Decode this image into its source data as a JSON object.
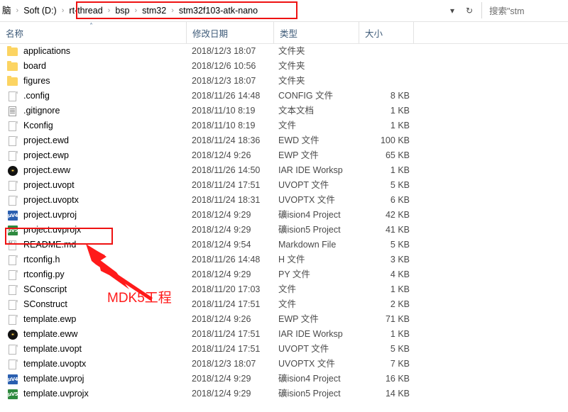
{
  "window": {
    "type": "file-explorer"
  },
  "address_bar": {
    "breadcrumbs": [
      {
        "label": "脑",
        "highlighted": false
      },
      {
        "label": "Soft (D:)",
        "highlighted": false
      },
      {
        "label": "rt-thread",
        "highlighted": true
      },
      {
        "label": "bsp",
        "highlighted": true
      },
      {
        "label": "stm32",
        "highlighted": true
      },
      {
        "label": "stm32f103-atk-nano",
        "highlighted": true
      }
    ],
    "separator": "›",
    "dropdown_icon": "chevron-down-icon",
    "refresh_icon": "refresh-icon",
    "refresh_glyph": "↻",
    "search_value": "搜索\"stm"
  },
  "columns": {
    "name": "名称",
    "date": "修改日期",
    "type": "类型",
    "size": "大小",
    "sort_caret": "˄"
  },
  "files": [
    {
      "name": "applications",
      "icon": "folder-icon",
      "date": "2018/12/3 18:07",
      "type": "文件夹",
      "size": ""
    },
    {
      "name": "board",
      "icon": "folder-icon",
      "date": "2018/12/6 10:56",
      "type": "文件夹",
      "size": ""
    },
    {
      "name": "figures",
      "icon": "folder-icon",
      "date": "2018/12/3 18:07",
      "type": "文件夹",
      "size": ""
    },
    {
      "name": ".config",
      "icon": "file-icon",
      "date": "2018/11/26 14:48",
      "type": "CONFIG 文件",
      "size": "8 KB"
    },
    {
      "name": ".gitignore",
      "icon": "text-document-icon",
      "date": "2018/11/10 8:19",
      "type": "文本文档",
      "size": "1 KB"
    },
    {
      "name": "Kconfig",
      "icon": "file-icon",
      "date": "2018/11/10 8:19",
      "type": "文件",
      "size": "1 KB"
    },
    {
      "name": "project.ewd",
      "icon": "file-icon",
      "date": "2018/11/24 18:36",
      "type": "EWD 文件",
      "size": "100 KB"
    },
    {
      "name": "project.ewp",
      "icon": "file-icon",
      "date": "2018/12/4 9:26",
      "type": "EWP 文件",
      "size": "65 KB"
    },
    {
      "name": "project.eww",
      "icon": "iar-workspace-icon",
      "date": "2018/11/26 14:50",
      "type": "IAR IDE Worksp",
      "size": "1 KB"
    },
    {
      "name": "project.uvopt",
      "icon": "file-icon",
      "date": "2018/11/24 17:51",
      "type": "UVOPT 文件",
      "size": "5 KB"
    },
    {
      "name": "project.uvoptx",
      "icon": "file-icon",
      "date": "2018/11/24 18:31",
      "type": "UVOPTX 文件",
      "size": "6 KB"
    },
    {
      "name": "project.uvproj",
      "icon": "uvision4-icon",
      "date": "2018/12/4 9:29",
      "type": "礦ision4 Project",
      "size": "42 KB"
    },
    {
      "name": "project.uvprojx",
      "icon": "uvision5-icon",
      "date": "2018/12/4 9:29",
      "type": "礦ision5 Project",
      "size": "41 KB"
    },
    {
      "name": "README.md",
      "icon": "markdown-icon",
      "date": "2018/12/4 9:54",
      "type": "Markdown File",
      "size": "5 KB"
    },
    {
      "name": "rtconfig.h",
      "icon": "file-icon",
      "date": "2018/11/26 14:48",
      "type": "H 文件",
      "size": "3 KB"
    },
    {
      "name": "rtconfig.py",
      "icon": "file-icon",
      "date": "2018/12/4 9:29",
      "type": "PY 文件",
      "size": "4 KB"
    },
    {
      "name": "SConscript",
      "icon": "file-icon",
      "date": "2018/11/20 17:03",
      "type": "文件",
      "size": "1 KB"
    },
    {
      "name": "SConstruct",
      "icon": "file-icon",
      "date": "2018/11/24 17:51",
      "type": "文件",
      "size": "2 KB"
    },
    {
      "name": "template.ewp",
      "icon": "file-icon",
      "date": "2018/12/4 9:26",
      "type": "EWP 文件",
      "size": "71 KB"
    },
    {
      "name": "template.eww",
      "icon": "iar-workspace-icon",
      "date": "2018/11/24 17:51",
      "type": "IAR IDE Worksp",
      "size": "1 KB"
    },
    {
      "name": "template.uvopt",
      "icon": "file-icon",
      "date": "2018/11/24 17:51",
      "type": "UVOPT 文件",
      "size": "5 KB"
    },
    {
      "name": "template.uvoptx",
      "icon": "file-icon",
      "date": "2018/12/3 18:07",
      "type": "UVOPTX 文件",
      "size": "7 KB"
    },
    {
      "name": "template.uvproj",
      "icon": "uvision4-icon",
      "date": "2018/12/4 9:29",
      "type": "礦ision4 Project",
      "size": "16 KB"
    },
    {
      "name": "template.uvprojx",
      "icon": "uvision5-icon",
      "date": "2018/12/4 9:29",
      "type": "礦ision5 Project",
      "size": "14 KB"
    }
  ],
  "annotations": {
    "color": "#ff1a1a",
    "label": "MDK5工程",
    "highlighted_file": "project.uvprojx",
    "highlighted_path": "rt-thread › bsp › stm32 › stm32f103-atk-nano"
  },
  "icon_glyphs": {
    "uvision4": "μV4",
    "uvision5": "μV5"
  }
}
